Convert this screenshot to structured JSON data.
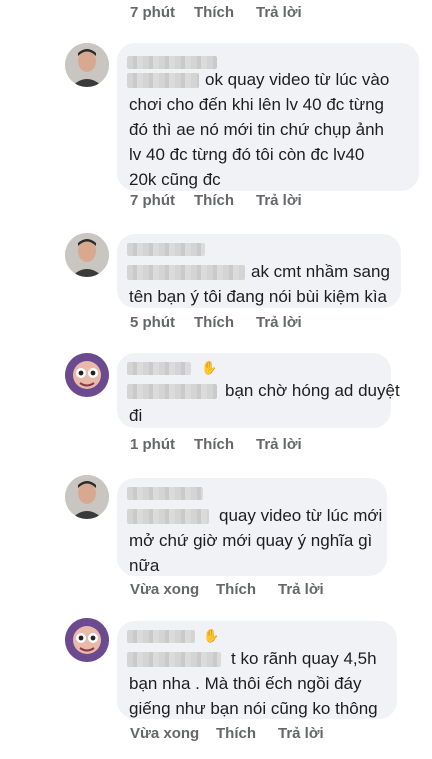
{
  "top_actions": {
    "time": "7 phút",
    "like": "Thích",
    "reply": "Trả lời"
  },
  "comments": [
    {
      "avatar": "male-avatar",
      "text_lines": [
        "ok quay video từ lúc vào",
        "chơi cho đến khi lên lv 40 đc từng",
        "đó thì ae nó mới tin chứ chụp ảnh",
        "lv 40 đc từng đó tôi còn đc lv40",
        "20k cũng đc"
      ],
      "time": "7 phút",
      "like": "Thích",
      "reply": "Trả lời"
    },
    {
      "avatar": "male-avatar",
      "text_lines": [
        "ak cmt nhầm sang",
        "tên bạn ý tôi đang nói bùi kiệm kìa"
      ],
      "time": "5 phút",
      "like": "Thích",
      "reply": "Trả lời"
    },
    {
      "avatar": "cartoon-avatar",
      "text_lines": [
        "bạn chờ hóng ad duyệt",
        "đi"
      ],
      "time": "1 phút",
      "like": "Thích",
      "reply": "Trả lời"
    },
    {
      "avatar": "male-avatar",
      "text_lines": [
        "quay video từ lúc mới",
        "mở chứ giờ mới quay ý nghĩa gì",
        "nữa"
      ],
      "time": "Vừa xong",
      "like": "Thích",
      "reply": "Trả lời"
    },
    {
      "avatar": "cartoon-avatar",
      "text_lines": [
        "t ko rãnh quay 4,5h",
        "bạn nha . Mà thôi ếch ngồi đáy",
        "giếng như bạn nói cũng ko thông"
      ],
      "time": "Vừa xong",
      "like": "Thích",
      "reply": "Trả lời"
    }
  ],
  "colors": {
    "bubble": "#f0f2f5",
    "meta": "#65676b",
    "text": "#1c1e21"
  }
}
